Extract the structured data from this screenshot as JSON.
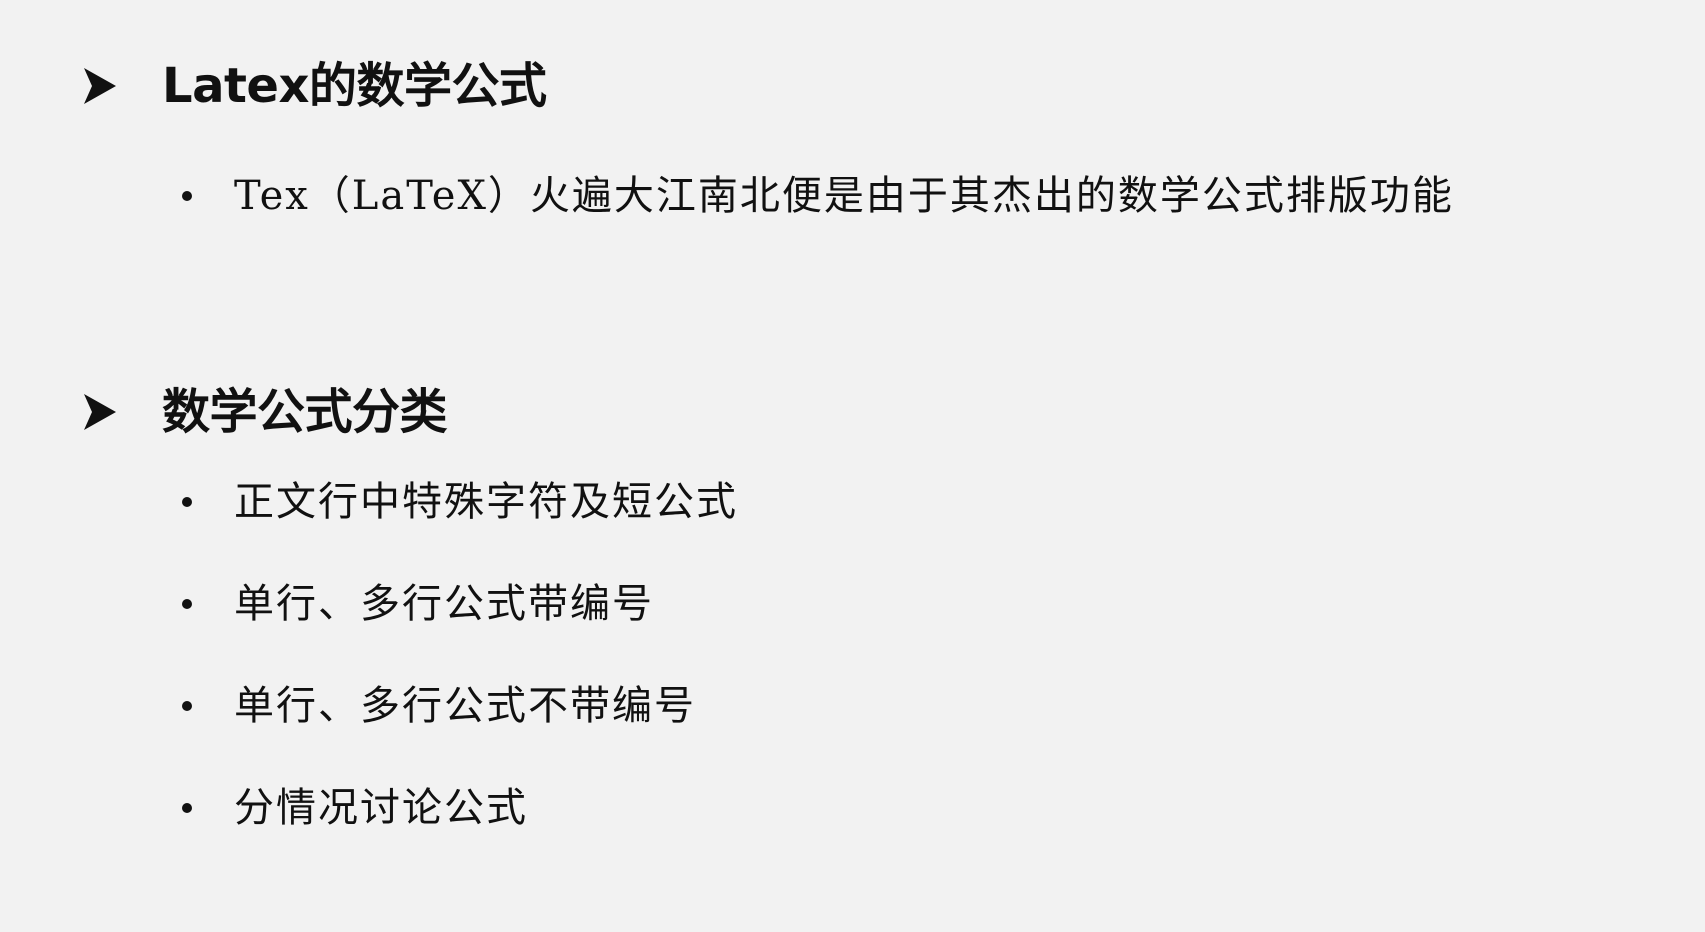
{
  "sections": [
    {
      "heading": "Latex的数学公式",
      "marker_icon": "arrowhead-icon",
      "items": [
        "Tex（LaTeX）火遍大江南北便是由于其杰出的数学公式排版功能"
      ]
    },
    {
      "heading": "数学公式分类",
      "marker_icon": "arrowhead-icon",
      "items": [
        "正文行中特殊字符及短公式",
        "单行、多行公式带编号",
        "单行、多行公式不带编号",
        "分情况讨论公式"
      ]
    }
  ],
  "colors": {
    "background": "#f2f2f2",
    "text": "#111111"
  }
}
